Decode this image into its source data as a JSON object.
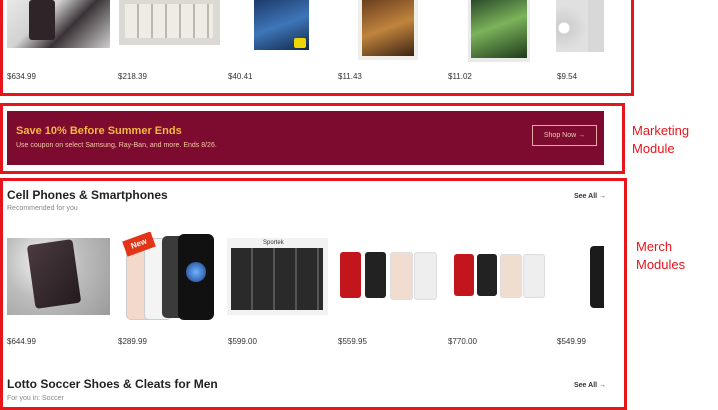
{
  "top_row": {
    "prices": [
      "$634.99",
      "$218.39",
      "$40.41",
      "$11.43",
      "$11.02",
      "$9.54"
    ]
  },
  "marketing": {
    "title": "Save 10% Before Summer Ends",
    "subtitle": "Use coupon on select Samsung, Ray-Ban, and more. Ends 8/26.",
    "button": "Shop Now →",
    "colors": {
      "background": "#7d0a2f",
      "title": "#f4b942"
    }
  },
  "merch": {
    "section1": {
      "title": "Cell Phones & Smartphones",
      "subtitle": "Recommended for you",
      "see_all": "See All →",
      "badge": "New",
      "box_label": "Sportek",
      "prices": [
        "$644.99",
        "$289.99",
        "$599.00",
        "$559.95",
        "$770.00",
        "$549.99"
      ]
    },
    "section2": {
      "title": "Lotto Soccer Shoes & Cleats for Men",
      "subtitle": "For you in: Soccer",
      "see_all": "See All →"
    }
  },
  "annotations": {
    "marketing": [
      "Marketing",
      "Module"
    ],
    "merch": [
      "Merch",
      "Modules"
    ],
    "color": "#e8141b"
  }
}
